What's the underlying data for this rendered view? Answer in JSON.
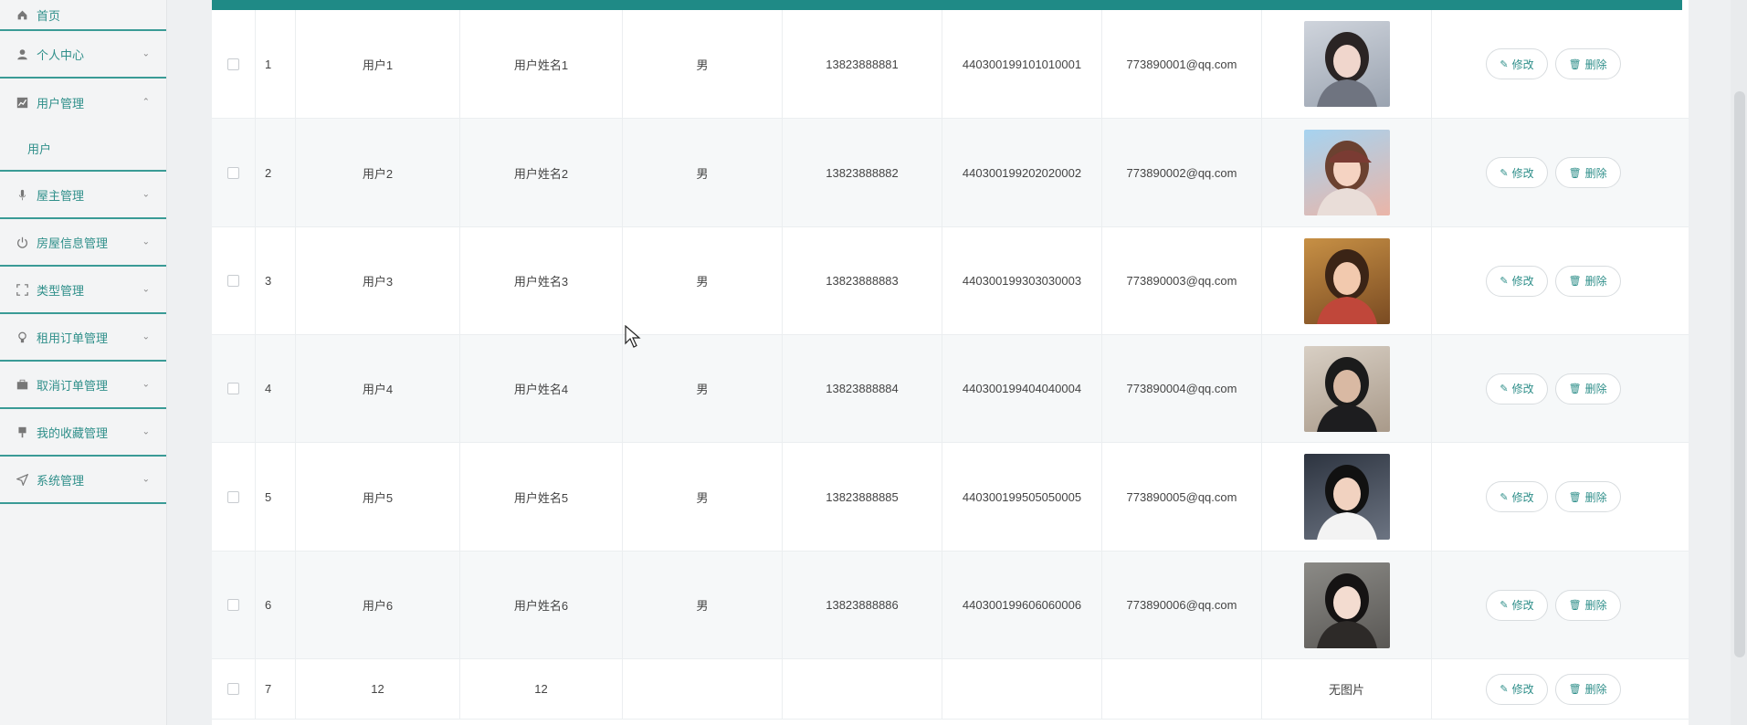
{
  "sidebar": {
    "items": [
      {
        "label": "首页",
        "icon": "home-icon"
      },
      {
        "label": "个人中心",
        "icon": "user-icon"
      },
      {
        "label": "用户管理",
        "icon": "chart-icon",
        "expanded": true,
        "children": [
          "用户"
        ]
      },
      {
        "label": "屋主管理",
        "icon": "mic-icon"
      },
      {
        "label": "房屋信息管理",
        "icon": "power-icon"
      },
      {
        "label": "类型管理",
        "icon": "frame-icon"
      },
      {
        "label": "租用订单管理",
        "icon": "bulb-icon"
      },
      {
        "label": "取消订单管理",
        "icon": "briefcase-icon"
      },
      {
        "label": "我的收藏管理",
        "icon": "flag-icon"
      },
      {
        "label": "系统管理",
        "icon": "send-icon"
      }
    ]
  },
  "actions": {
    "edit": "修改",
    "delete": "删除"
  },
  "rows": [
    {
      "index": "1",
      "account": "用户1",
      "name": "用户姓名1",
      "gender": "男",
      "phone": "13823888881",
      "idcard": "440300199101010001",
      "email": "773890001@qq.com",
      "photo": "photo-1"
    },
    {
      "index": "2",
      "account": "用户2",
      "name": "用户姓名2",
      "gender": "男",
      "phone": "13823888882",
      "idcard": "440300199202020002",
      "email": "773890002@qq.com",
      "photo": "photo-2"
    },
    {
      "index": "3",
      "account": "用户3",
      "name": "用户姓名3",
      "gender": "男",
      "phone": "13823888883",
      "idcard": "440300199303030003",
      "email": "773890003@qq.com",
      "photo": "photo-3"
    },
    {
      "index": "4",
      "account": "用户4",
      "name": "用户姓名4",
      "gender": "男",
      "phone": "13823888884",
      "idcard": "440300199404040004",
      "email": "773890004@qq.com",
      "photo": "photo-4"
    },
    {
      "index": "5",
      "account": "用户5",
      "name": "用户姓名5",
      "gender": "男",
      "phone": "13823888885",
      "idcard": "440300199505050005",
      "email": "773890005@qq.com",
      "photo": "photo-5"
    },
    {
      "index": "6",
      "account": "用户6",
      "name": "用户姓名6",
      "gender": "男",
      "phone": "13823888886",
      "idcard": "440300199606060006",
      "email": "773890006@qq.com",
      "photo": "photo-6"
    },
    {
      "index": "7",
      "account": "12",
      "name": "12",
      "gender": "",
      "phone": "",
      "idcard": "",
      "email": "",
      "photo": "",
      "no_image": "无图片"
    }
  ],
  "colors": {
    "accent": "#1f8a86",
    "text_accent": "#2f8f8a"
  }
}
